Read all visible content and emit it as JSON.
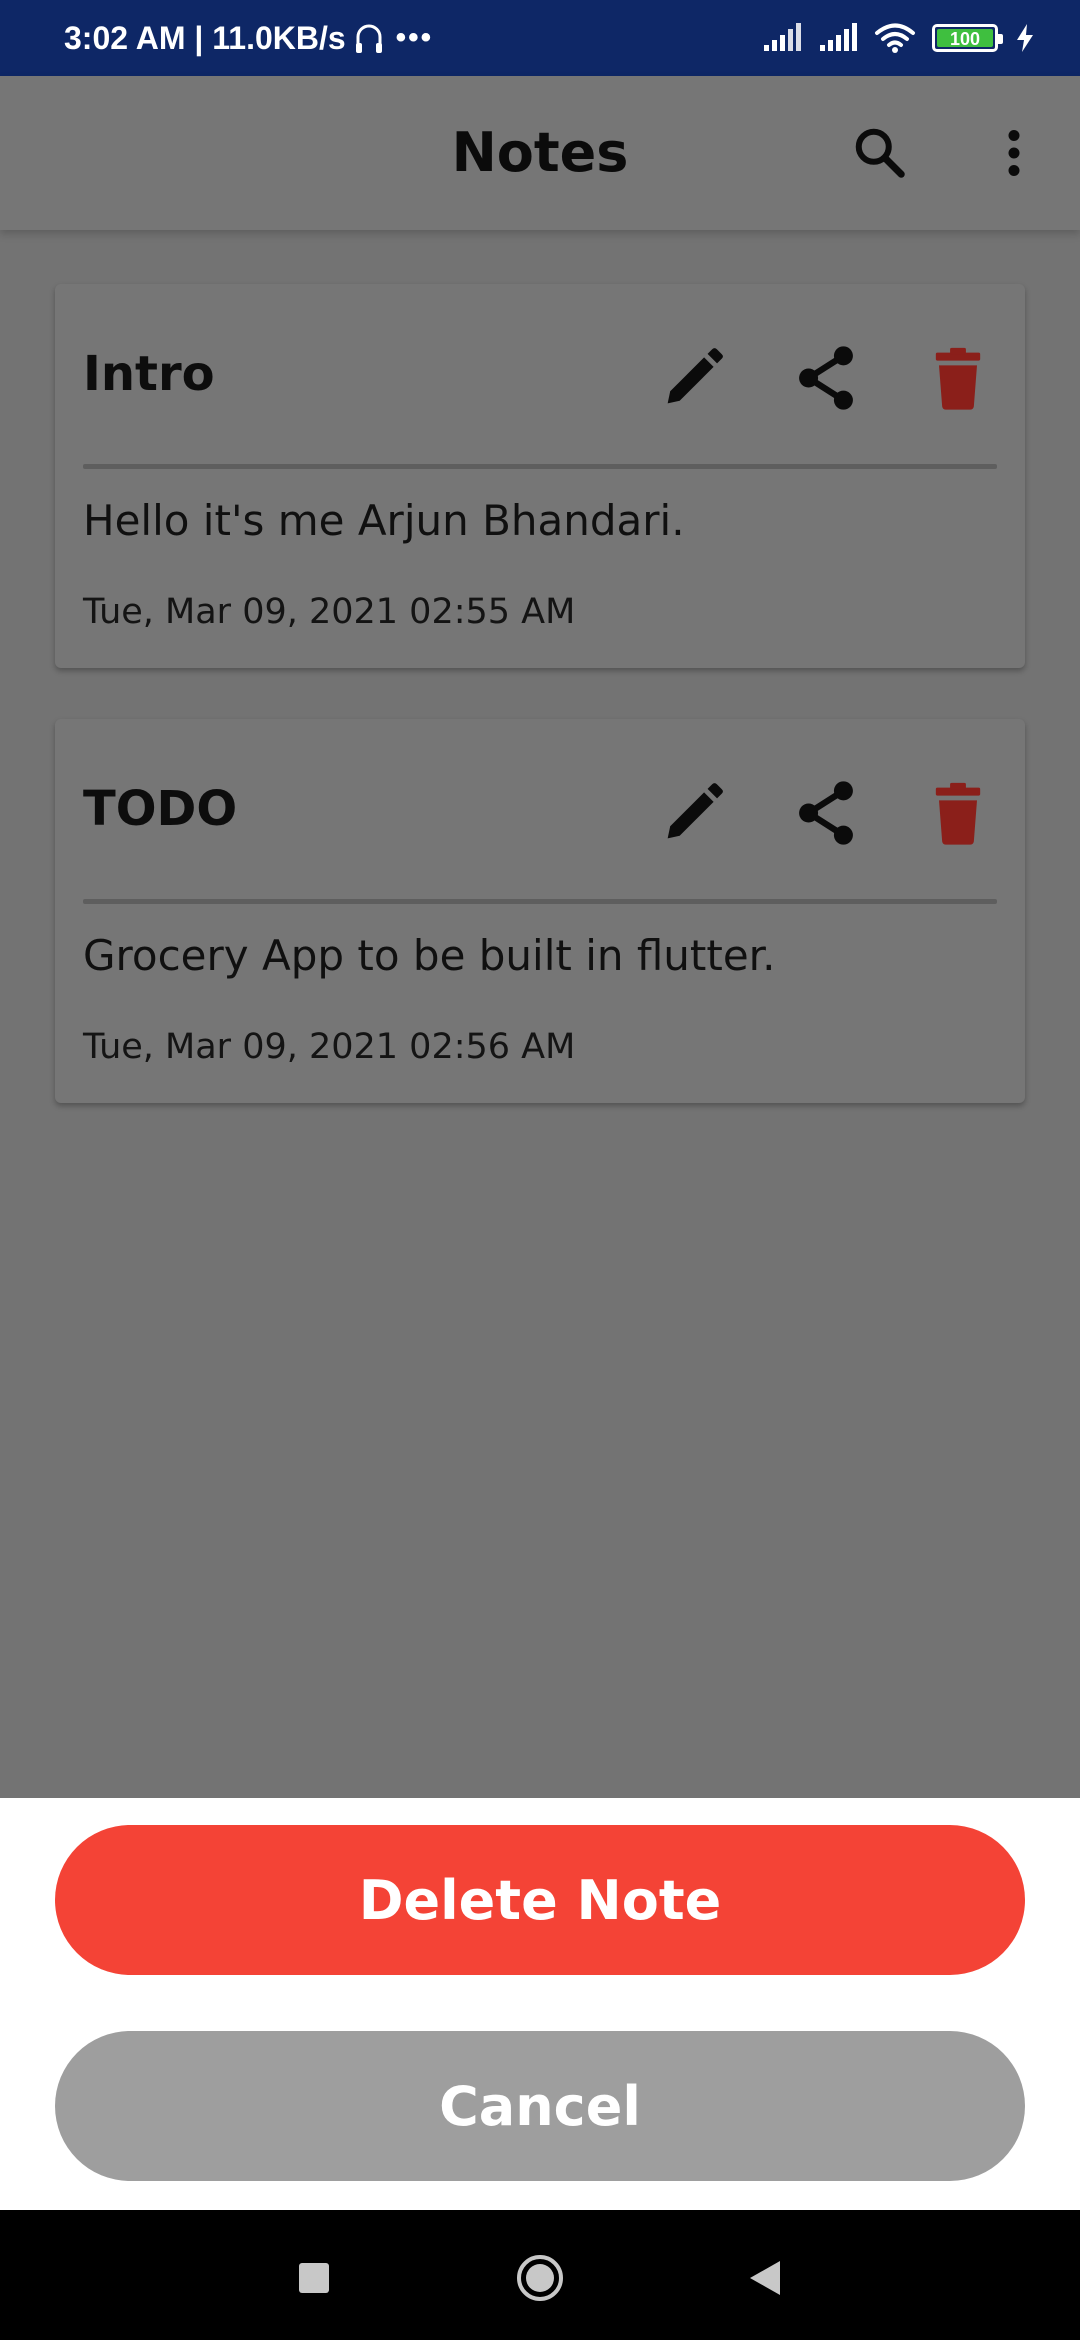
{
  "status_bar": {
    "time_speed": "3:02 AM | 11.0KB/s",
    "more_dots": "•••",
    "battery_level": "100",
    "icons": [
      "headphones-icon",
      "signal-icon",
      "signal-icon",
      "wifi-icon",
      "battery-icon",
      "charging-icon"
    ]
  },
  "app_bar": {
    "title": "Notes",
    "icons": [
      "search-icon",
      "more-vert-icon"
    ]
  },
  "notes": [
    {
      "title": "Intro",
      "body": "Hello it's me Arjun Bhandari.",
      "date": "Tue, Mar 09, 2021 02:55 AM"
    },
    {
      "title": "TODO",
      "body": "Grocery App to be built in flutter.",
      "date": "Tue, Mar 09, 2021 02:56 AM"
    }
  ],
  "card_action_icons": [
    "edit-icon",
    "share-icon",
    "delete-icon"
  ],
  "sheet": {
    "delete_label": "Delete Note",
    "cancel_label": "Cancel"
  },
  "colors": {
    "status_bar": "#0e2766",
    "scrim_background": "#737373",
    "delete_icon": "#8b1f1a",
    "delete_button": "#f44336",
    "cancel_button": "#9e9e9e"
  },
  "nav_bar": {
    "icons": [
      "recents-square-icon",
      "home-circle-icon",
      "back-triangle-icon"
    ]
  }
}
